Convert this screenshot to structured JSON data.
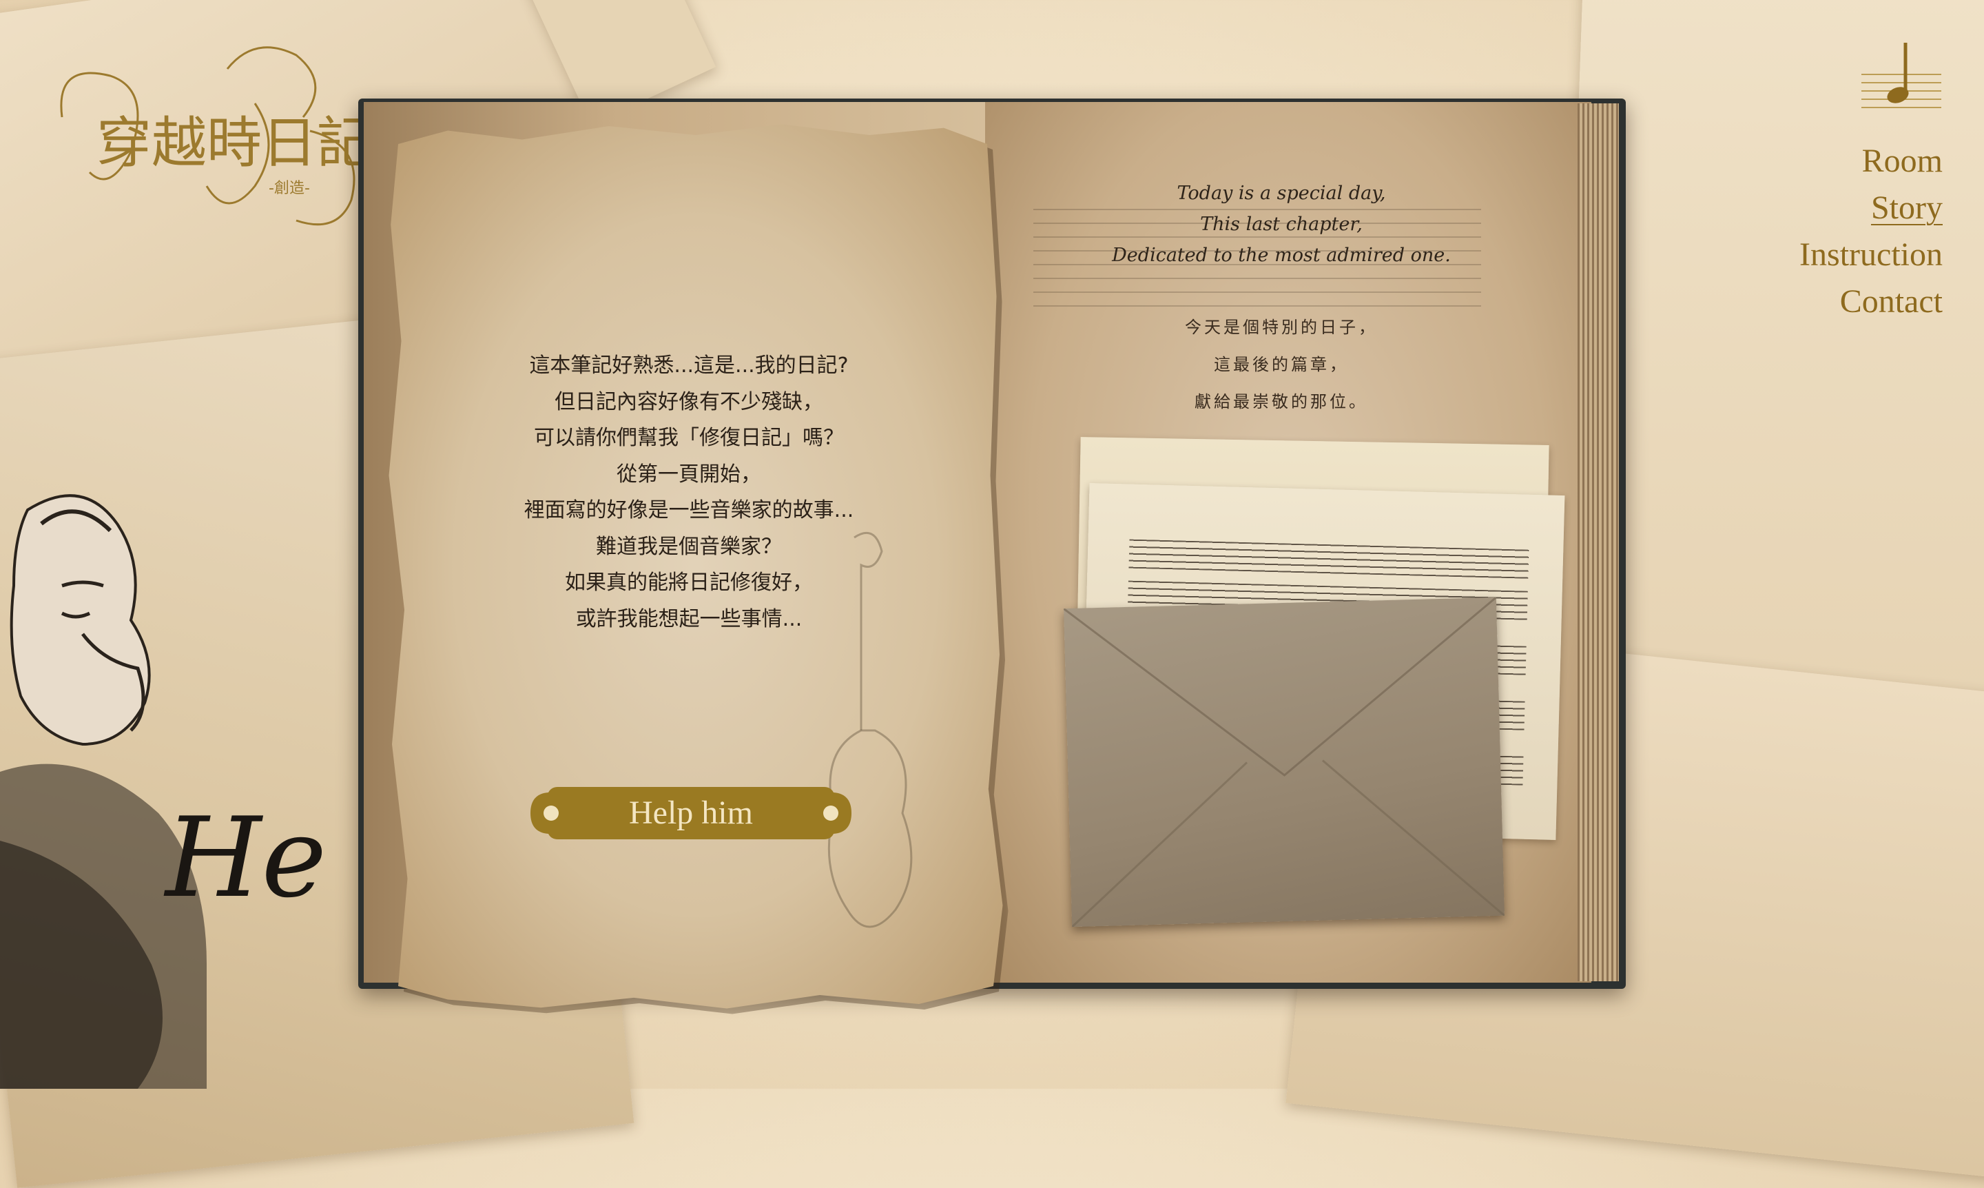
{
  "logo": {
    "title": "穿越時日記",
    "subtitle": "-創造-"
  },
  "nav": {
    "items": [
      {
        "label": "Room"
      },
      {
        "label": "Story"
      },
      {
        "label": "Instruction"
      },
      {
        "label": "Contact"
      }
    ],
    "active": "Story"
  },
  "left_page": {
    "lines": [
      "這本筆記好熟悉...這是...我的日記?",
      "但日記內容好像有不少殘缺，",
      "可以請你們幫我「修復日記」嗎？",
      "從第一頁開始，",
      "裡面寫的好像是一些音樂家的故事...",
      "難道我是個音樂家？",
      "如果真的能將日記修復好，",
      "或許我能想起一些事情..."
    ],
    "button_label": "Help him"
  },
  "right_page": {
    "english_lines": [
      "Today is a special day,",
      "This last chapter,",
      "Dedicated to the most admired one."
    ],
    "chinese_lines": [
      "今天是個特別的日子，",
      "這最後的篇章，",
      "獻給最崇敬的那位。"
    ]
  },
  "signature": "He",
  "colors": {
    "gold": "#8e6a1e",
    "button": "#9a7a22",
    "button_text": "#f4e6c2"
  },
  "icons": {
    "music": "music-note-icon"
  }
}
